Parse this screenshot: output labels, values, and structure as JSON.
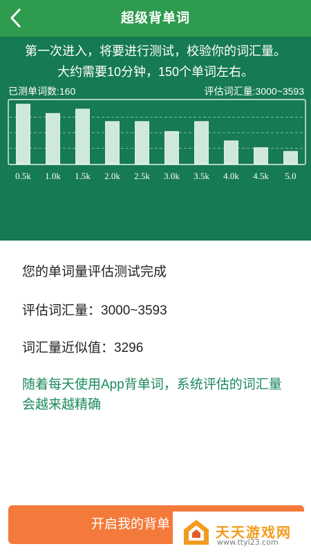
{
  "header": {
    "title": "超级背单词",
    "back_icon": "chevron-left-icon",
    "background": "#2f9b4f"
  },
  "intro": {
    "line1": "第一次进入，将要进行测试，校验你的词汇量。",
    "line2": "大约需要10分钟，150个单词左右。",
    "panel_color": "#167a53"
  },
  "stats": {
    "tested": "已测单词数:160",
    "estimate": "评估词汇量:3000~3593"
  },
  "chart_data": {
    "type": "bar",
    "categories": [
      "0.5k",
      "1.0k",
      "1.5k",
      "2.0k",
      "2.5k",
      "3.0k",
      "3.5k",
      "4.0k",
      "4.5k",
      "5.0"
    ],
    "values": [
      0.96,
      0.81,
      0.88,
      0.68,
      0.68,
      0.52,
      0.68,
      0.37,
      0.26,
      0.2
    ],
    "ylim": [
      0,
      1
    ],
    "grid": true,
    "bar_color": "#cfe8dc"
  },
  "results": {
    "done": "您的单词量评估测试完成",
    "estimate_label": "评估词汇量：",
    "estimate_value": "3000~3593",
    "approx_label": "词汇量近似值：",
    "approx_value": "3296",
    "note": "随着每天使用App背单词，系统评估的词汇量会越来越精确",
    "note_color": "#1a8a5c"
  },
  "action": {
    "start_label": "开启我的背单",
    "button_color": "#f37a3a"
  },
  "watermark": {
    "name": "天天游戏网",
    "url": "www.ttyl23.com",
    "logo_icon": "house-logo-icon"
  }
}
